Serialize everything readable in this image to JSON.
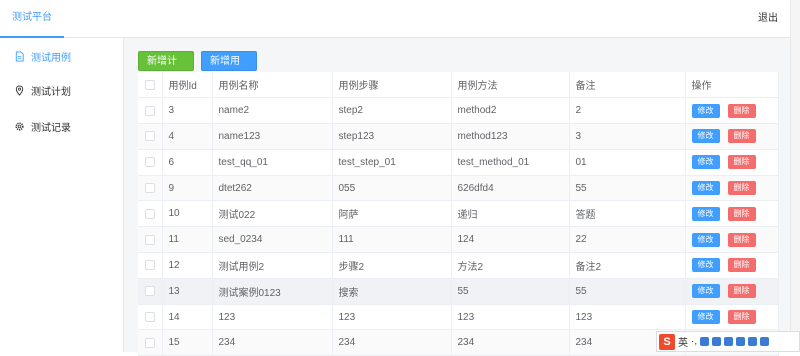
{
  "header": {
    "brand": "测试平台",
    "logout": "退出"
  },
  "sidebar": {
    "items": [
      {
        "label": "测试用例",
        "icon": "document-icon"
      },
      {
        "label": "测试计划",
        "icon": "location-pin-icon"
      },
      {
        "label": "测试记录",
        "icon": "gear-icon"
      }
    ]
  },
  "toolbar": {
    "add_plan": "新增计划",
    "add_case": "新增用例"
  },
  "table": {
    "headers": [
      "用例Id",
      "用例名称",
      "用例步骤",
      "用例方法",
      "备注",
      "操作"
    ],
    "edit_label": "修改",
    "delete_label": "删除",
    "rows": [
      [
        "3",
        "name2",
        "step2",
        "method2",
        "2"
      ],
      [
        "4",
        "name123",
        "step123",
        "method123",
        "3"
      ],
      [
        "6",
        "test_qq_01",
        "test_step_01",
        "test_method_01",
        "01"
      ],
      [
        "9",
        "dtet262",
        "055",
        "626dfd4",
        "55"
      ],
      [
        "10",
        "测试022",
        "阿萨",
        "递归",
        "答题"
      ],
      [
        "11",
        "sed_0234",
        "111",
        "124",
        "22"
      ],
      [
        "12",
        "测试用例2",
        "步骤2",
        "方法2",
        "备注2"
      ],
      [
        "13",
        "测试案例0123",
        "搜索",
        "55",
        "55"
      ],
      [
        "14",
        "123",
        "123",
        "123",
        "123"
      ],
      [
        "15",
        "234",
        "234",
        "234",
        "234"
      ]
    ]
  },
  "ime": {
    "mode": "英"
  },
  "colors": {
    "accent": "#409eff",
    "success": "#67c23a",
    "danger": "#f56c6c"
  }
}
